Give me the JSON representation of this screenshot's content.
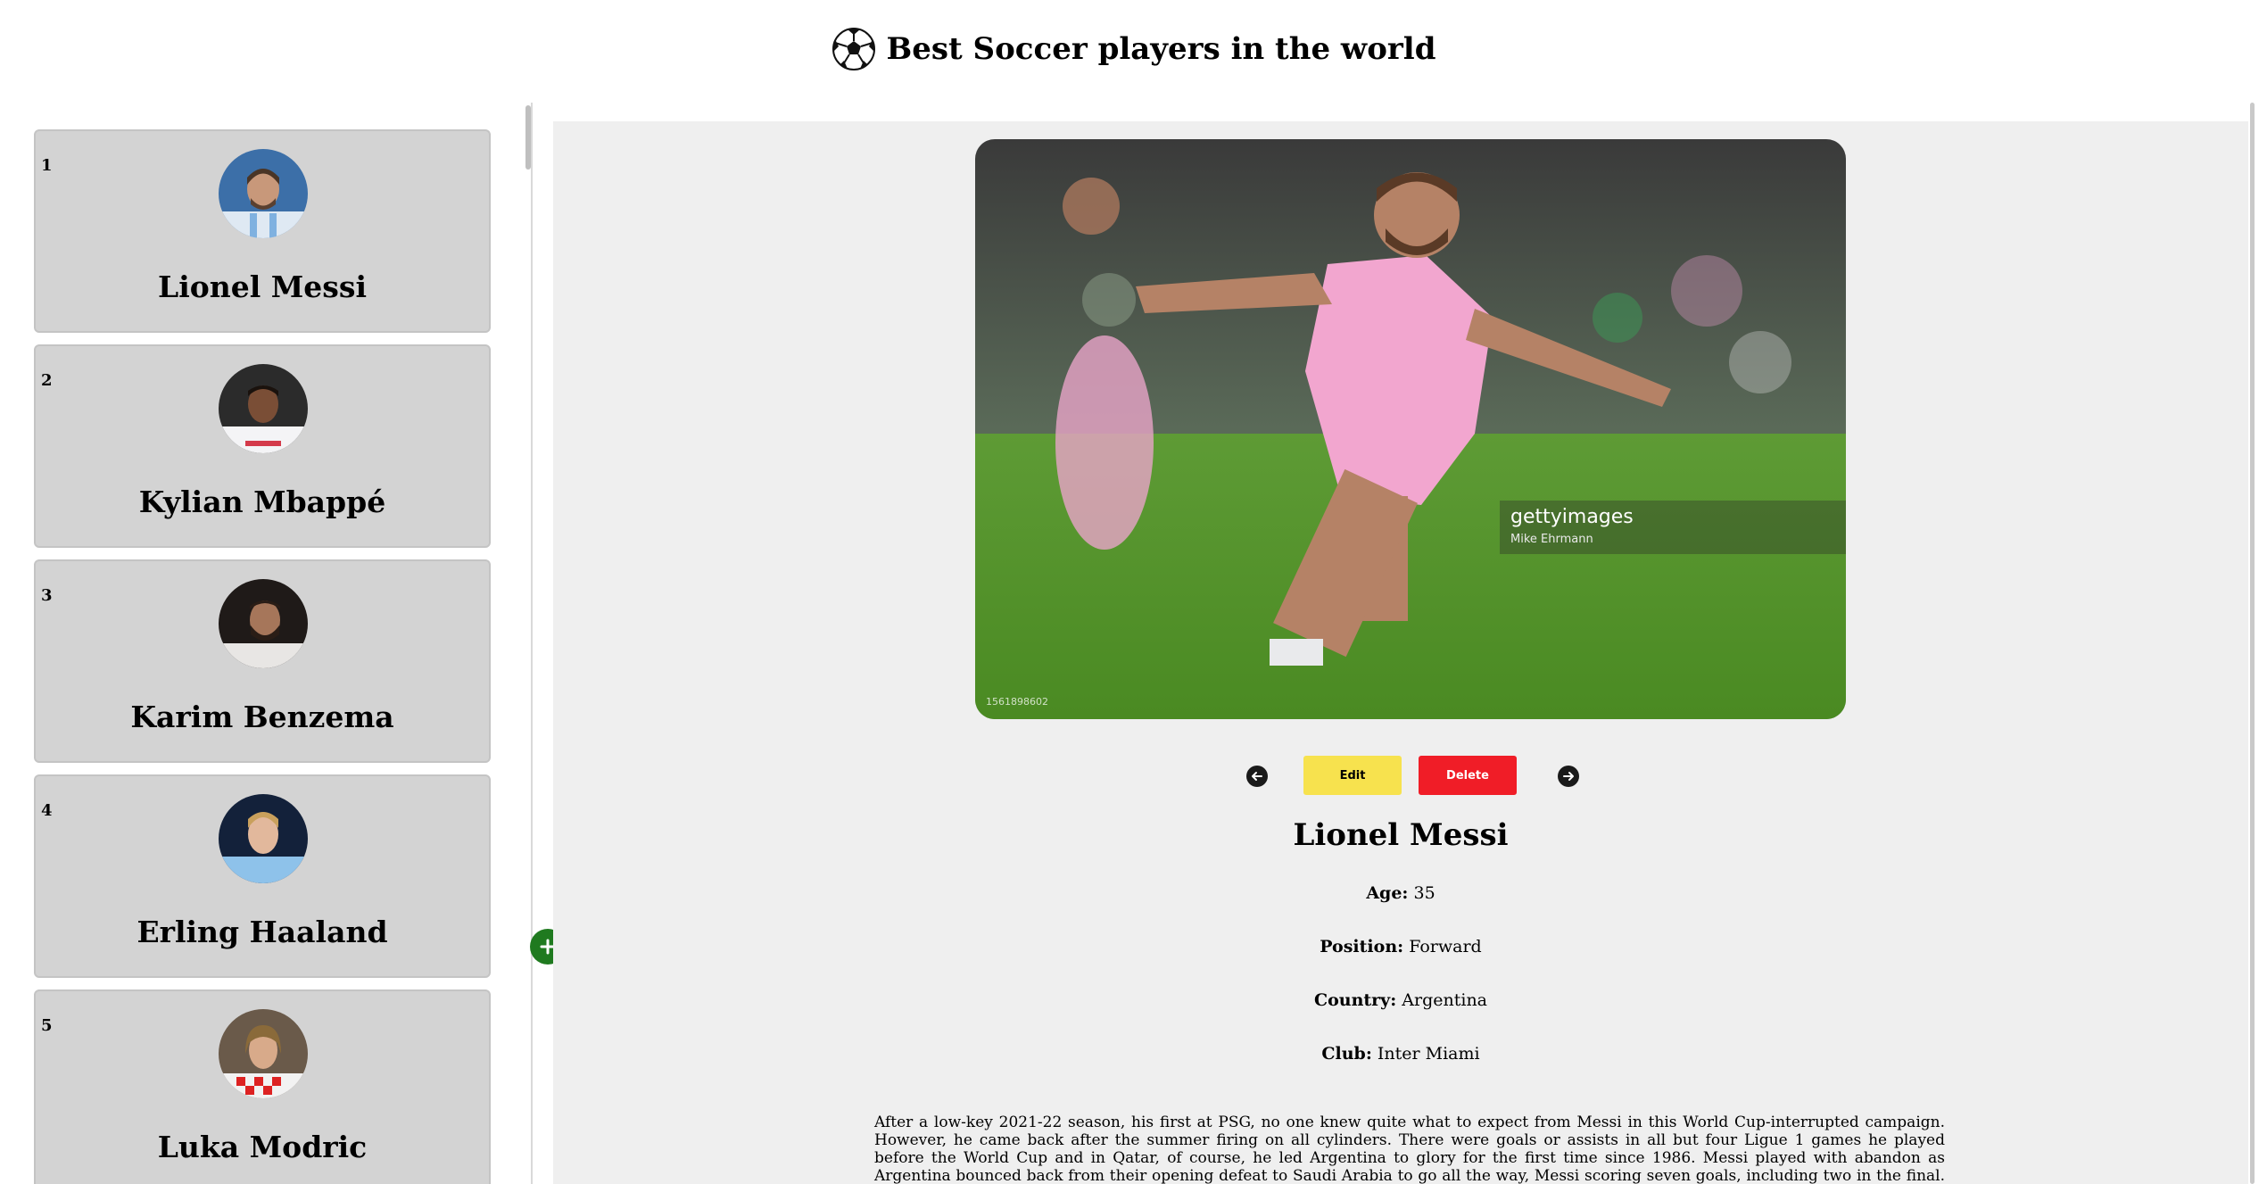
{
  "header": {
    "title": "Best Soccer players in the world",
    "icon": "soccer-ball-icon"
  },
  "players": [
    {
      "rank": "1",
      "name": "Lionel Messi"
    },
    {
      "rank": "2",
      "name": "Kylian Mbappé"
    },
    {
      "rank": "3",
      "name": "Karim Benzema"
    },
    {
      "rank": "4",
      "name": "Erling Haaland"
    },
    {
      "rank": "5",
      "name": "Luka Modric"
    }
  ],
  "detail": {
    "image": {
      "watermark_brand": "gettyimages",
      "watermark_credit": "Mike Ehrmann",
      "image_id": "1561898602"
    },
    "controls": {
      "edit_label": "Edit",
      "delete_label": "Delete",
      "prev_icon": "arrow-left-icon",
      "next_icon": "arrow-right-icon"
    },
    "name": "Lionel Messi",
    "fields": {
      "age_label": "Age:",
      "age": "35",
      "position_label": "Position:",
      "position": "Forward",
      "country_label": "Country:",
      "country": "Argentina",
      "club_label": "Club:",
      "club": "Inter Miami"
    },
    "bio": "After a low-key 2021-22 season, his first at PSG, no one knew quite what to expect from Messi in this World Cup-interrupted campaign. However, he came back after the summer firing on all cylinders. There were goals or assists in all but four Ligue 1 games he played before the World Cup and in Qatar, of course, he led Argentina to glory for the first time since 1986. Messi played with abandon as Argentina bounced back from their opening defeat to Saudi Arabia to go all the way, Messi scoring seven goals, including two in the final. He tops our list for a remarkable sixth time with every single judge of the 206-strong panel having him on their voting slip and with 156 of them putting him at No 1."
  },
  "colors": {
    "edit": "#f7e24e",
    "delete": "#f01d27",
    "add": "#1f7a1f",
    "card": "#d3d3d3",
    "panel": "#efefef"
  }
}
